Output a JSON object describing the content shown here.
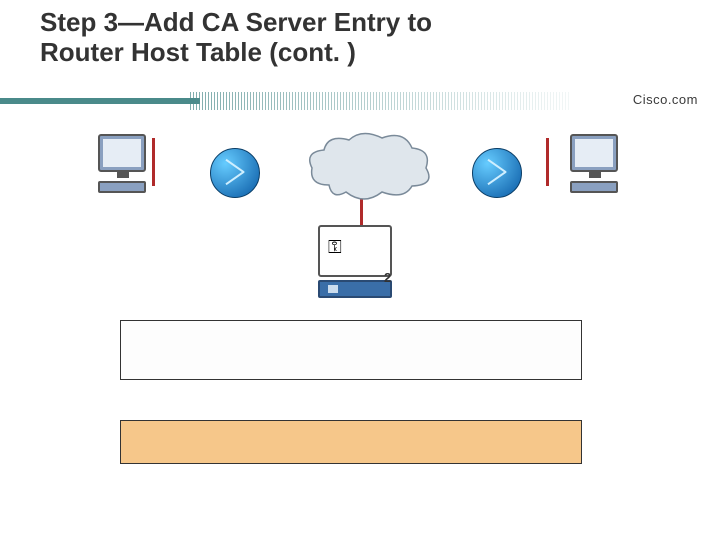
{
  "title_line1": "Step 3—Add CA Server Entry to",
  "title_line2": "Router Host Table (cont. )",
  "brand": "Cisco.com",
  "diagram": {
    "left_pc_name": "pc-left",
    "right_pc_name": "pc-right",
    "router_left_name": "router-left",
    "router_right_name": "router-right",
    "cloud_name": "network-cloud",
    "ca_server_name": "ca-server",
    "ca_key_glyph": "⚿",
    "ca_label": "2"
  },
  "box1_text": "",
  "box2_text": ""
}
